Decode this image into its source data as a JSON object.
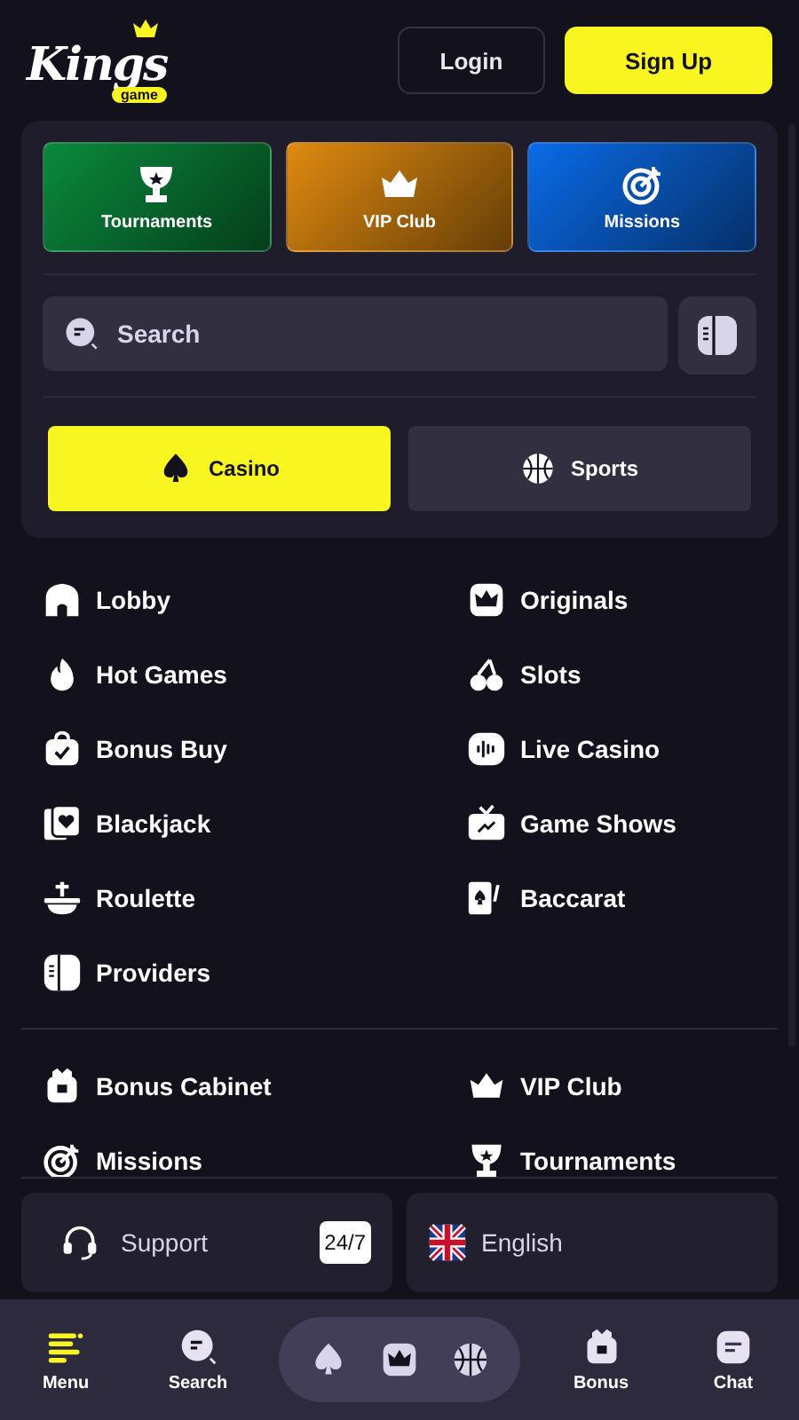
{
  "header": {
    "logo": {
      "title": "Kings",
      "subtitle": "game"
    },
    "buttons": [
      {
        "kind": "outline",
        "label": "Login"
      },
      {
        "kind": "primary",
        "label": "Sign Up"
      }
    ]
  },
  "quick_links": [
    {
      "label": "Tournaments",
      "color": "#0a8a3c"
    },
    {
      "label": "VIP Club",
      "color": "#e08a10"
    },
    {
      "label": "Missions",
      "color": "#0a6be8"
    }
  ],
  "search": {
    "placeholder": "Search"
  },
  "mode_tabs": [
    {
      "label": "Casino",
      "selected": true
    },
    {
      "label": "Sports",
      "selected": false
    }
  ],
  "menu_sections": [
    {
      "items": [
        "Lobby",
        "Originals",
        "Hot Games",
        "Slots",
        "Bonus Buy",
        "Live Casino",
        "Blackjack",
        "Game Shows",
        "Roulette",
        "Baccarat",
        "Providers"
      ]
    },
    {
      "items": [
        "Bonus Cabinet",
        "VIP Club",
        "Missions",
        "Tournaments"
      ]
    }
  ],
  "support": {
    "label": "Support",
    "badge": "24/7"
  },
  "language": {
    "label": "English"
  },
  "bottom_nav": [
    {
      "label": "Menu",
      "selected": true
    },
    {
      "label": "Search",
      "selected": false
    },
    {
      "kind": "games"
    },
    {
      "label": "Bonus",
      "selected": false
    },
    {
      "label": "Chat",
      "selected": false
    }
  ]
}
